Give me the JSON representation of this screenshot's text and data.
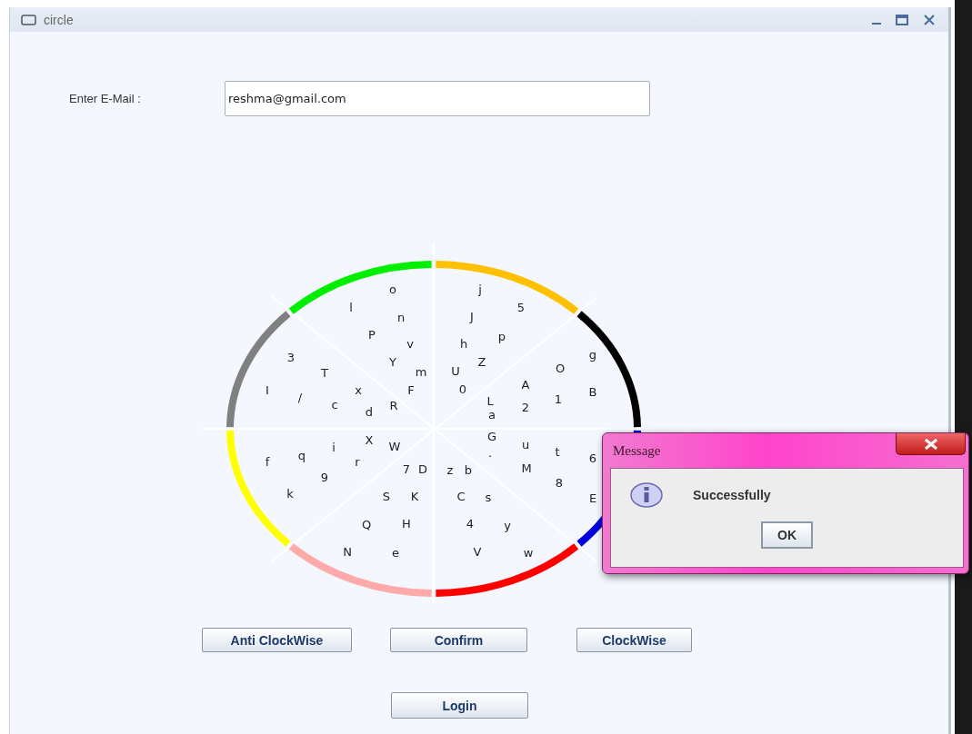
{
  "window": {
    "title": "circle"
  },
  "email": {
    "label": "Enter E-Mail :",
    "value": "reshma@gmail.com"
  },
  "wheel": {
    "sectors": [
      {
        "color": "#ffc000"
      },
      {
        "color": "#000000"
      },
      {
        "color": "#0000dd"
      },
      {
        "color": "#ff0000"
      },
      {
        "color": "#ffaaaa"
      },
      {
        "color": "#ffff00"
      },
      {
        "color": "#808080"
      },
      {
        "color": "#00ee00"
      }
    ],
    "letters": [
      "o",
      "j",
      "l",
      "5",
      "n",
      "J",
      "P",
      "p",
      "v",
      "h",
      "3",
      "Y",
      "Z",
      "g",
      "T",
      "m",
      "U",
      "O",
      "I",
      "x",
      "F",
      "0",
      "A",
      "B",
      "/",
      "L",
      "1",
      "c",
      "R",
      "2",
      "d",
      "a",
      "X",
      "G",
      "i",
      "W",
      "u",
      "f",
      "q",
      "r",
      ".",
      "t",
      "6",
      "7",
      "D",
      "z",
      "b",
      "M",
      "9",
      "8",
      "k",
      "S",
      "K",
      "C",
      "s",
      "E",
      "Q",
      "H",
      "4",
      "y",
      "N",
      "e",
      "V",
      "w"
    ]
  },
  "buttons": [
    "Anti ClockWise",
    "Confirm",
    "ClockWise"
  ],
  "login_button": "Login",
  "dialog": {
    "title": "Message",
    "message": "Successfully",
    "button": "OK"
  }
}
